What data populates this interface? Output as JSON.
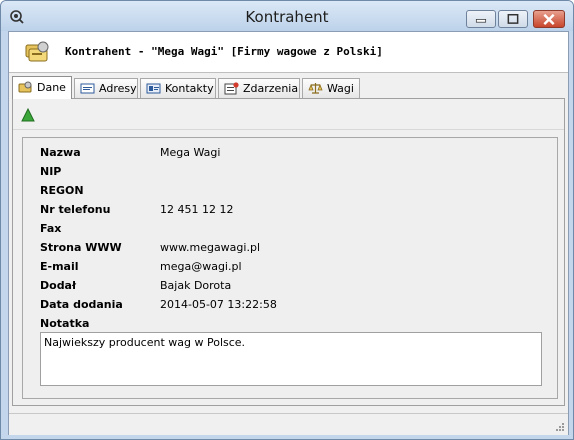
{
  "window": {
    "title": "Kontrahent",
    "title_icon": "gear-key-icon",
    "controls": [
      "minimize-icon",
      "maximize-icon",
      "close-icon"
    ]
  },
  "header": {
    "icon": "contractor-cards-icon",
    "title": "Kontrahent - \"Mega Wagi\" [Firmy wagowe z Polski]"
  },
  "tabs": [
    {
      "label": "Dane",
      "icon": "folder-coins-icon",
      "active": true
    },
    {
      "label": "Adresy",
      "icon": "address-card-icon",
      "active": false
    },
    {
      "label": "Kontakty",
      "icon": "contacts-card-icon",
      "active": false
    },
    {
      "label": "Zdarzenia",
      "icon": "events-calendar-icon",
      "active": false
    },
    {
      "label": "Wagi",
      "icon": "scale-icon",
      "active": false
    }
  ],
  "toolbar": {
    "add_icon": "green-triangle-up-icon"
  },
  "fields": [
    {
      "label": "Nazwa",
      "value": "Mega Wagi"
    },
    {
      "label": "NIP",
      "value": ""
    },
    {
      "label": "REGON",
      "value": ""
    },
    {
      "label": "Nr telefonu",
      "value": "12 451 12 12"
    },
    {
      "label": "Fax",
      "value": ""
    },
    {
      "label": "Strona WWW",
      "value": "www.megawagi.pl"
    },
    {
      "label": "E-mail",
      "value": "mega@wagi.pl"
    },
    {
      "label": "Dodał",
      "value": "Bajak Dorota"
    },
    {
      "label": "Data dodania",
      "value": "2014-05-07 13:22:58"
    }
  ],
  "note": {
    "label": "Notatka",
    "value": "Najwiekszy producent wag w Polsce."
  },
  "colors": {
    "accent_green": "#3aa63a",
    "close_red": "#c8462c",
    "frame_blue": "#c3d6ec"
  }
}
